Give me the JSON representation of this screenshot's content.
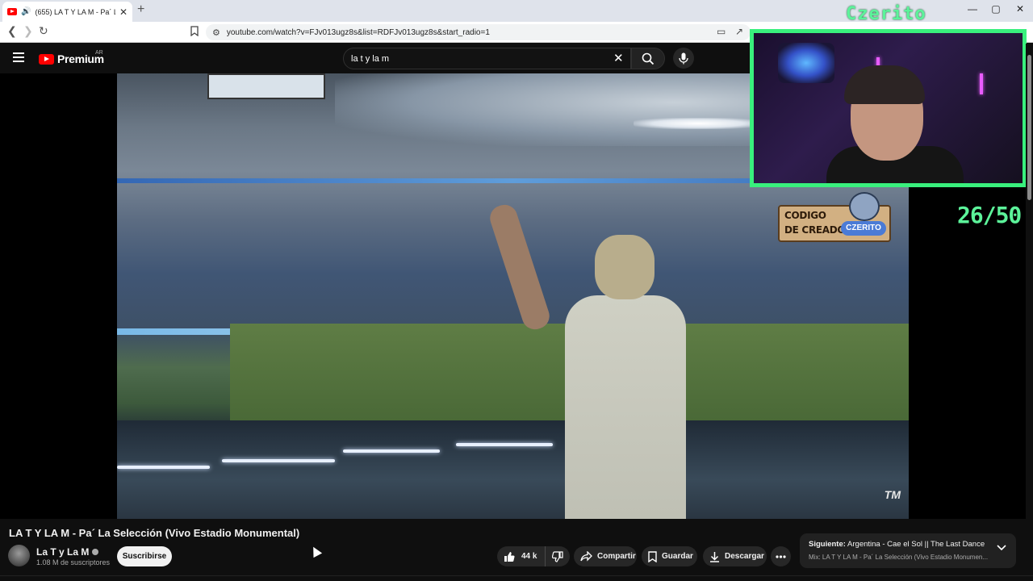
{
  "browser": {
    "tab_title": "(655) LA T Y LA M - Pa´ La Se",
    "url": "youtube.com/watch?v=FJv013ugz8s&list=RDFJv013ugz8s&start_radio=1",
    "window_controls": [
      "—",
      "▢",
      "✕"
    ]
  },
  "header": {
    "logo_text": "Premium",
    "country_code": "AR",
    "search_value": "la t y la m"
  },
  "video": {
    "watermark": "TM"
  },
  "overlay": {
    "streamer_name": "Czerito",
    "creator_code_line1": "CODIGO",
    "creator_code_line2": "DE CREADOR",
    "creator_code_name": "CZERITO",
    "counter": "26/50",
    "colors": {
      "accent": "#39f07d"
    }
  },
  "main": {
    "title": "LA T Y LA M - Pa´ La Selección (Vivo Estadio Monumental)",
    "channel_name": "La T y La M",
    "subscribers": "1.08 M de suscriptores",
    "subscribe_label": "Suscribirse",
    "likes": "44 k",
    "share_label": "Compartir",
    "save_label": "Guardar",
    "download_label": "Descargar"
  },
  "up_next": {
    "label": "Siguiente:",
    "title": "Argentina - Cae el Sol || The Last Dance",
    "mix": "Mix: LA T Y LA M - Pa´ La Selección (Vivo Estadio Monumen..."
  }
}
